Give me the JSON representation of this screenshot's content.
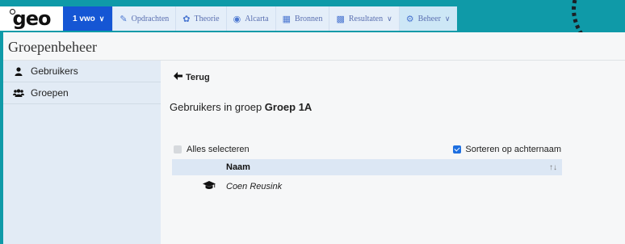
{
  "nav": {
    "logo": "geo",
    "level": {
      "label": "1 vwo",
      "caret": "∨"
    },
    "items": [
      {
        "label": "Opdrachten",
        "icon": "edit-icon"
      },
      {
        "label": "Theorie",
        "icon": "leaf-icon"
      },
      {
        "label": "Alcarta",
        "icon": "globe-icon"
      },
      {
        "label": "Bronnen",
        "icon": "book-icon"
      },
      {
        "label": "Resultaten",
        "icon": "chart-icon",
        "caret": "∨"
      },
      {
        "label": "Beheer",
        "icon": "gear-icon",
        "caret": "∨"
      }
    ]
  },
  "page": {
    "title": "Groepenbeheer"
  },
  "sidebar": {
    "items": [
      {
        "label": "Gebruikers",
        "icon": "user-icon"
      },
      {
        "label": "Groepen",
        "icon": "users-icon"
      }
    ]
  },
  "content": {
    "back_label": "Terug",
    "heading_prefix": "Gebruikers in groep",
    "group_name": "Groep 1A",
    "select_all_label": "Alles selecteren",
    "select_all_checked": false,
    "sort_label": "Sorteren op achternaam",
    "sort_checked": true,
    "table": {
      "column_name": "Naam",
      "sort_glyph": "↑↓",
      "rows": [
        {
          "name": "Coen Reusink",
          "icon": "graduation-cap-icon"
        }
      ]
    }
  },
  "colors": {
    "background": "#0f9aa8",
    "level_tab": "#1556d4",
    "nav_item": "#e4eef9",
    "sidebar": "#e2ebf5",
    "table_header": "#dce7f4",
    "checkbox_checked": "#1e6fe0"
  }
}
